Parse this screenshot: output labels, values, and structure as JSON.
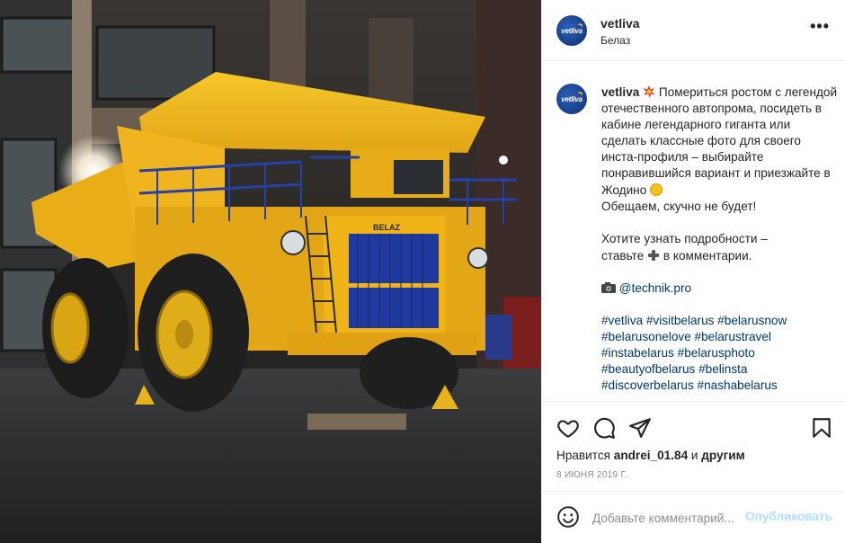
{
  "post": {
    "username": "vetliva",
    "location": "Белаз",
    "avatar_text": "vetliva",
    "more_icon": "more-horizontal-icon"
  },
  "caption": {
    "username": "vetliva",
    "line1": "Помериться ростом с легендой отечественного автопрома, посидеть в кабине легендарного гиганта или сделать классные фото для своего инста-профиля – выбирайте понравившийся вариант и приезжайте в Жодино",
    "line2": "Обещаем, скучно не будет!",
    "line3a": "Хотите узнать подробности –",
    "line3b": "ставьте",
    "line3c": "в комментарии.",
    "mention": "@technik.pro",
    "tags": [
      "#vetliva",
      "#visitbelarus",
      "#belarusnow",
      "#belarusonelove",
      "#belarustravel",
      "#instabelarus",
      "#belarusphoto",
      "#beautyofbelarus",
      "#belinsta",
      "#discoverbelarus",
      "#nashabelarus"
    ]
  },
  "actions": {
    "likes_prefix": "Нравится",
    "likes_user": "andrei_01.84",
    "likes_middle": "и",
    "likes_others": "другим",
    "date": "8 ИЮНЯ 2019 Г."
  },
  "comment": {
    "placeholder": "Добавьте комментарий...",
    "post_label": "Опубликовать"
  },
  "photo": {
    "truck_brand": "BELAZ"
  },
  "colors": {
    "link": "#00376b",
    "post_button_disabled": "#b2dffc",
    "muted": "#8e8e8e",
    "truck_yellow": "#f2b91a"
  }
}
